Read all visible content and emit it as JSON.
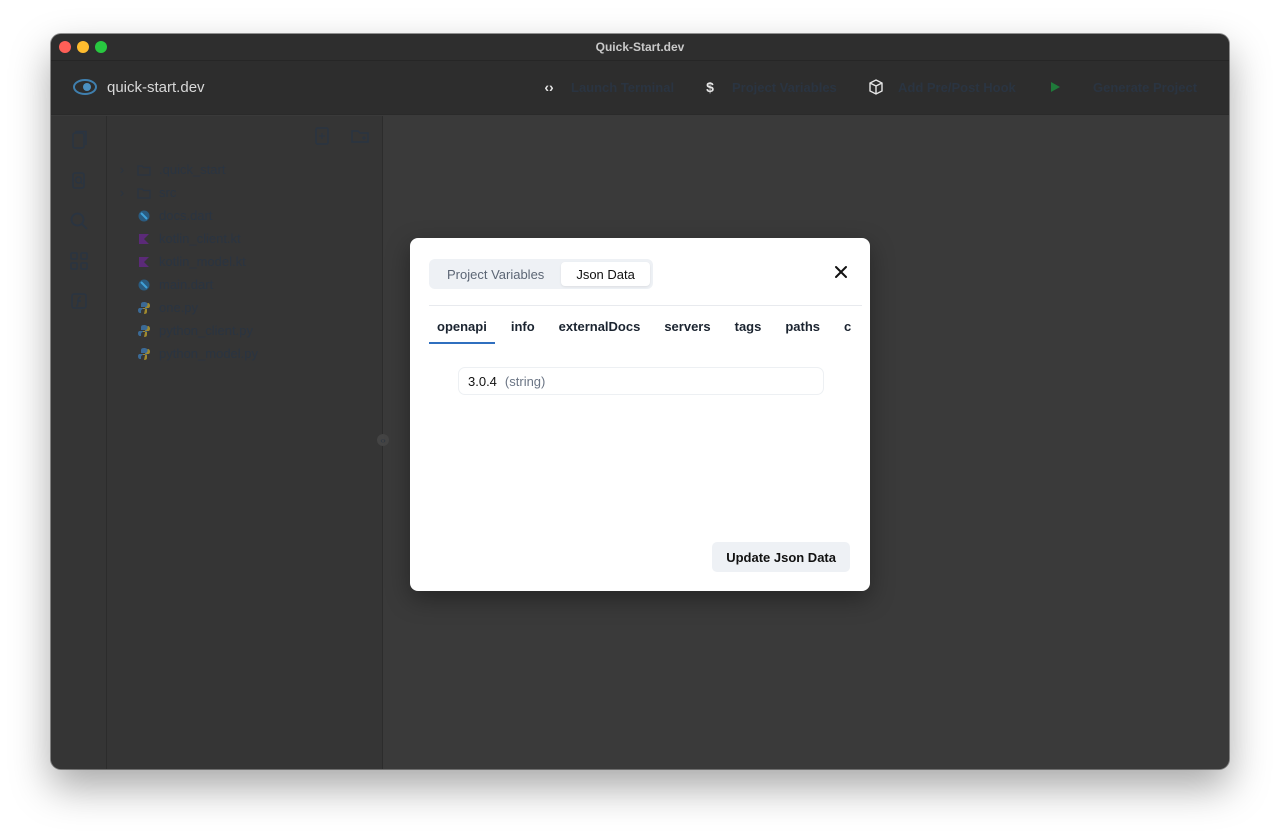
{
  "window": {
    "title": "Quick-Start.dev"
  },
  "toolbar": {
    "brand": "quick-start.dev",
    "actions": [
      {
        "label": "Launch Terminal",
        "icon": "code-icon"
      },
      {
        "label": "Project Variables",
        "icon": "dollar-icon"
      },
      {
        "label": "Add Pre/Post Hook",
        "icon": "package-icon"
      },
      {
        "label": "Generate Project",
        "icon": "play-icon"
      }
    ]
  },
  "explorer": {
    "items": [
      {
        "label": ".quick_start",
        "kind": "folder",
        "expandable": true
      },
      {
        "label": "src",
        "kind": "folder",
        "expandable": true
      },
      {
        "label": "docs.dart",
        "kind": "dart"
      },
      {
        "label": "kotlin_client.kt",
        "kind": "kotlin"
      },
      {
        "label": "kotlin_model.kt",
        "kind": "kotlin"
      },
      {
        "label": "main.dart",
        "kind": "dart"
      },
      {
        "label": "one.py",
        "kind": "python"
      },
      {
        "label": "python_client.py",
        "kind": "python"
      },
      {
        "label": "python_model.py",
        "kind": "python"
      }
    ]
  },
  "modal": {
    "segments": [
      {
        "label": "Project Variables",
        "active": false
      },
      {
        "label": "Json Data",
        "active": true
      }
    ],
    "tabs": [
      {
        "label": "openapi",
        "active": true
      },
      {
        "label": "info"
      },
      {
        "label": "externalDocs"
      },
      {
        "label": "servers"
      },
      {
        "label": "tags"
      },
      {
        "label": "paths"
      },
      {
        "label": "components"
      }
    ],
    "value": "3.0.4",
    "value_type": "(string)",
    "update_label": "Update Json Data"
  },
  "colors": {
    "accent": "#2f6fbf",
    "toolbar_label": "#2a3441",
    "background": "#3a3a3a"
  }
}
